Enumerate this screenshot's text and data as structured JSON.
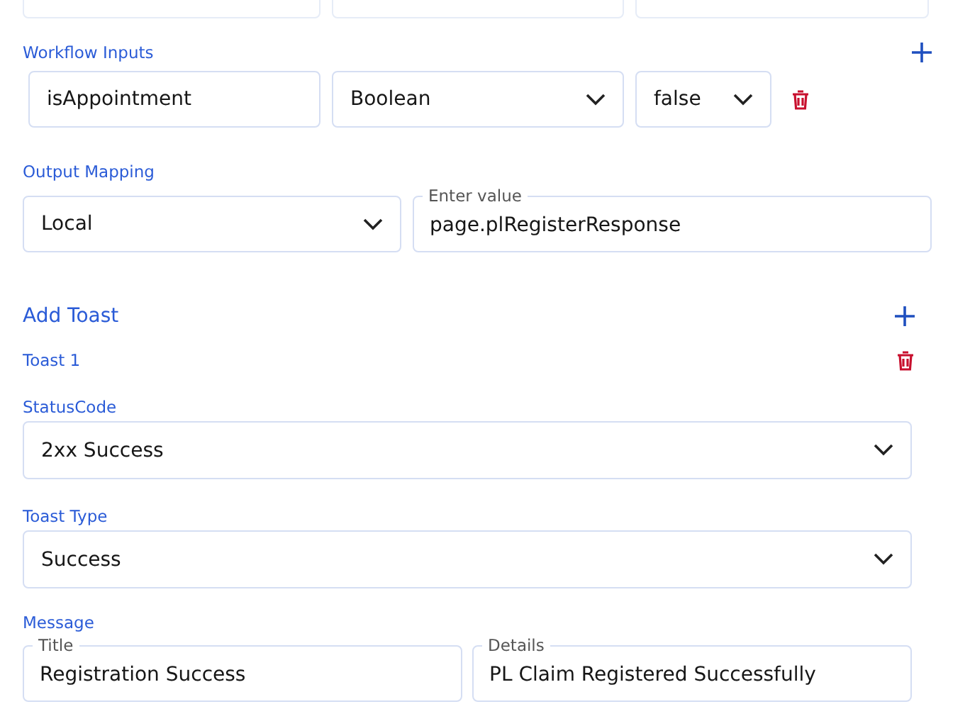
{
  "top_row": [
    {
      "kind": "input"
    },
    {
      "kind": "input"
    },
    {
      "kind": "input"
    }
  ],
  "workflow_inputs": {
    "label": "Workflow Inputs",
    "rows": [
      {
        "name": "isAppointment",
        "type": "Boolean",
        "value": "false"
      }
    ]
  },
  "output_mapping": {
    "label": "Output Mapping",
    "scope": "Local",
    "value_label": "Enter value",
    "value": "page.plRegisterResponse"
  },
  "add_toast": {
    "label": "Add Toast",
    "toasts": [
      {
        "title": "Toast 1",
        "status_code_label": "StatusCode",
        "status_code": "2xx Success",
        "type_label": "Toast Type",
        "type": "Success",
        "message_label": "Message",
        "message_title_label": "Title",
        "message_title": "Registration Success",
        "details_label": "Details",
        "details": "PL Claim Registered Successfully"
      }
    ]
  }
}
